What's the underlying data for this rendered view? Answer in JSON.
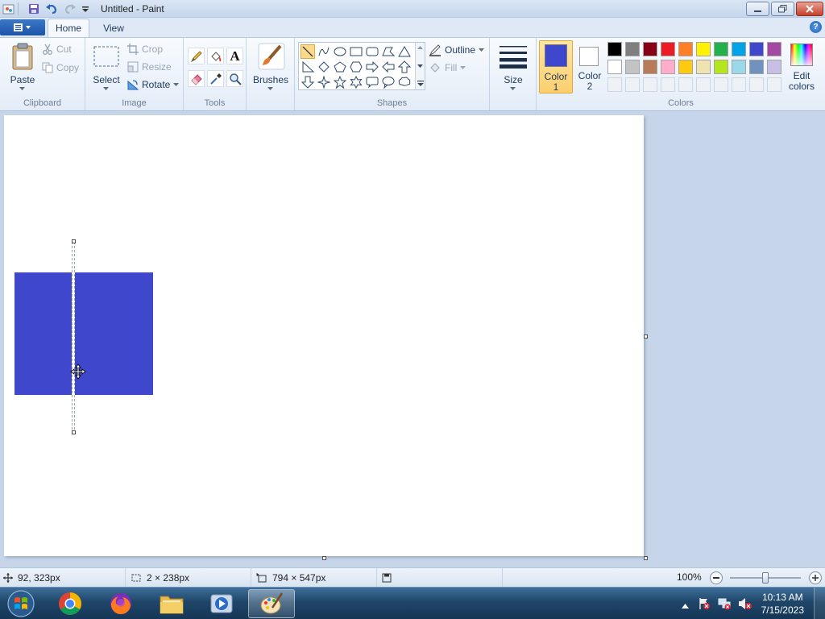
{
  "window": {
    "title": "Untitled - Paint",
    "minimize_icon": "minimize-icon",
    "maximize_icon": "restore-icon",
    "close_icon": "close-icon"
  },
  "ribbon_tabs": [
    {
      "label": "Home",
      "active": true
    },
    {
      "label": "View",
      "active": false
    }
  ],
  "clipboard": {
    "group_label": "Clipboard",
    "paste": "Paste",
    "cut": "Cut",
    "copy": "Copy"
  },
  "image": {
    "group_label": "Image",
    "select": "Select",
    "crop": "Crop",
    "resize": "Resize",
    "rotate": "Rotate"
  },
  "tools": {
    "group_label": "Tools",
    "items": [
      "pencil-icon",
      "fill-icon",
      "text-icon",
      "eraser-icon",
      "color-picker-icon",
      "magnifier-icon"
    ]
  },
  "brushes": {
    "label": "Brushes"
  },
  "shapes": {
    "group_label": "Shapes",
    "outline": "Outline",
    "fill": "Fill",
    "items": [
      "line",
      "curve",
      "oval",
      "rectangle",
      "rounded-rectangle",
      "polygon",
      "triangle",
      "right-triangle",
      "diamond",
      "pentagon",
      "hexagon",
      "right-arrow",
      "left-arrow",
      "up-arrow",
      "down-arrow",
      "four-point-star",
      "five-point-star",
      "six-point-star",
      "rounded-callout",
      "oval-callout",
      "cloud-callout"
    ]
  },
  "size": {
    "label": "Size"
  },
  "colors": {
    "group_label": "Colors",
    "color1_line1": "Color",
    "color1_line2": "1",
    "color2_line1": "Color",
    "color2_line2": "2",
    "color1_value": "#3f48cc",
    "color2_value": "#ffffff",
    "edit_line1": "Edit",
    "edit_line2": "colors",
    "palette_row1": [
      "#000000",
      "#7f7f7f",
      "#880015",
      "#ed1c24",
      "#ff7f27",
      "#fff200",
      "#22b14c",
      "#00a2e8",
      "#3f48cc",
      "#a349a4"
    ],
    "palette_row2": [
      "#ffffff",
      "#c3c3c3",
      "#b97a57",
      "#ffaec9",
      "#ffc90e",
      "#efe4b0",
      "#b5e61d",
      "#99d9ea",
      "#7092be",
      "#c8bfe7"
    ],
    "palette_row3": [
      "",
      "",
      "",
      "",
      "",
      "",
      "",
      "",
      "",
      ""
    ]
  },
  "canvas": {
    "shape_color": "#3f48cc",
    "background": "#ffffff"
  },
  "status": {
    "cursor_pos": "92, 323px",
    "selection_size": "2 × 238px",
    "image_size": "794 × 547px",
    "zoom": "100%"
  },
  "taskbar": {
    "time": "10:13 AM",
    "date": "7/15/2023",
    "apps": [
      "start-orb",
      "chrome-icon",
      "firefox-icon",
      "file-explorer-icon",
      "media-player-icon",
      "paint-icon"
    ]
  }
}
